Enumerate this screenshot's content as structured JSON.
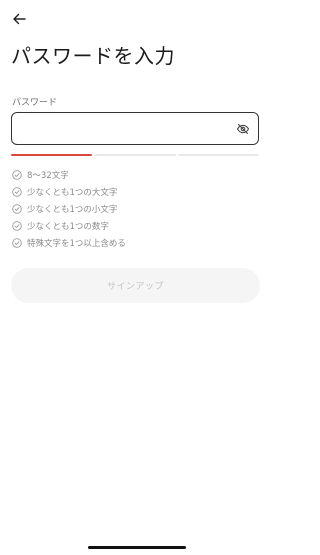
{
  "header": {
    "back_icon": "arrow-left-icon",
    "title": "パスワードを入力"
  },
  "password_field": {
    "label": "パスワード",
    "value": "",
    "placeholder": "",
    "visibility_icon": "eye-off-icon",
    "strength": {
      "segments_total": 3,
      "segments_filled": 1,
      "color": "#d9473c"
    }
  },
  "requirements": [
    {
      "text": "8〜32文字",
      "icon": "check-circle-icon"
    },
    {
      "text": "少なくとも1つの大文字",
      "icon": "check-circle-icon"
    },
    {
      "text": "少なくとも1つの小文字",
      "icon": "check-circle-icon"
    },
    {
      "text": "少なくとも1つの数字",
      "icon": "check-circle-icon"
    },
    {
      "text": "特殊文字を1つ以上含める",
      "icon": "check-circle-icon"
    }
  ],
  "signup_button": {
    "label": "サインアップ",
    "disabled": true
  },
  "colors": {
    "text_primary": "#1b1b1b",
    "muted": "#8a8a8a",
    "button_disabled_bg": "#f5f5f5",
    "button_disabled_text": "#c4c4c4"
  }
}
